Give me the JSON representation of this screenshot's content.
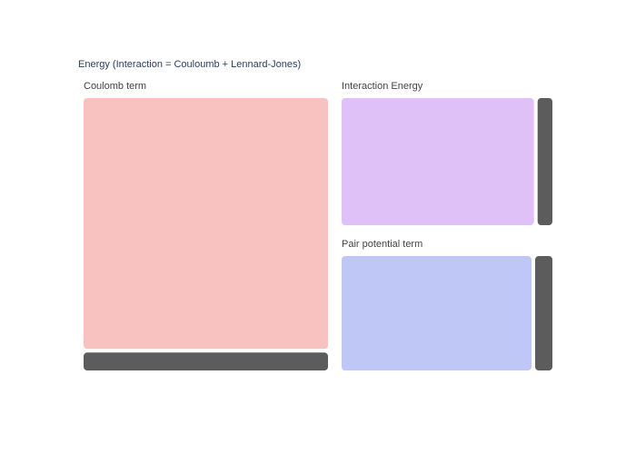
{
  "chart_data": {
    "type": "treemap",
    "title": "",
    "root": {
      "label": "Energy (Interaction = Couloumb + Lennard-Jones)",
      "children": [
        {
          "label": "Coulomb term",
          "value": 60,
          "color": "#f7c2c0",
          "children": [
            {
              "label": "",
              "value": 56,
              "color": "#f7c2c0"
            },
            {
              "label": "",
              "value": 4,
              "color": "#5c5c5c"
            }
          ]
        },
        {
          "label": "Interaction Energy",
          "value": 28,
          "color": "#dfc0f7",
          "children": [
            {
              "label": "",
              "value": 26,
              "color": "#dfc0f7"
            },
            {
              "label": "",
              "value": 2,
              "color": "#5c5c5c"
            }
          ]
        },
        {
          "label": "Pair potential term",
          "value": 24,
          "color": "#bfc7f7",
          "children": [
            {
              "label": "",
              "value": 22,
              "color": "#bfc7f7"
            },
            {
              "label": "",
              "value": 2,
              "color": "#5c5c5c"
            }
          ]
        }
      ]
    },
    "colors": {
      "coulomb": "#f7c2c0",
      "interaction": "#dfc0f7",
      "pair": "#bfc7f7",
      "remainder": "#5c5c5c",
      "root_label": "#2a3f5f",
      "parent_label": "#444444"
    }
  }
}
